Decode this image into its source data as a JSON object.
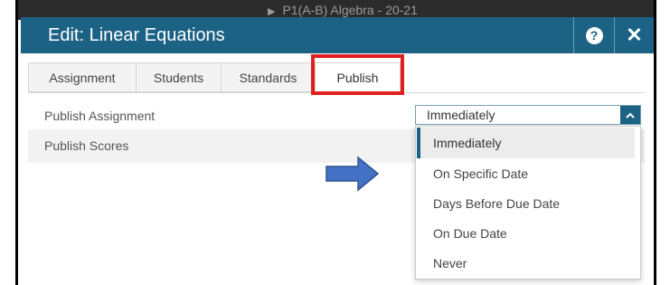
{
  "background": {
    "title_text": "P1(A-B) Algebra - 20-21"
  },
  "dialog": {
    "title": "Edit: Linear Equations",
    "help_icon": "question-circle-icon",
    "close_icon": "close-icon",
    "header_color": "#1b6285"
  },
  "tabs": [
    {
      "label": "Assignment"
    },
    {
      "label": "Students"
    },
    {
      "label": "Standards"
    },
    {
      "label": "Publish",
      "active": true
    }
  ],
  "settings": {
    "publish_assignment_label": "Publish Assignment",
    "publish_scores_label": "Publish Scores"
  },
  "publish_select": {
    "value": "Immediately",
    "options": [
      {
        "label": "Immediately",
        "selected": true
      },
      {
        "label": "On Specific Date"
      },
      {
        "label": "Days Before Due Date"
      },
      {
        "label": "On Due Date"
      },
      {
        "label": "Never"
      }
    ]
  },
  "annotations": {
    "highlight_color": "#e02020",
    "arrow_color": "#4472c4"
  }
}
